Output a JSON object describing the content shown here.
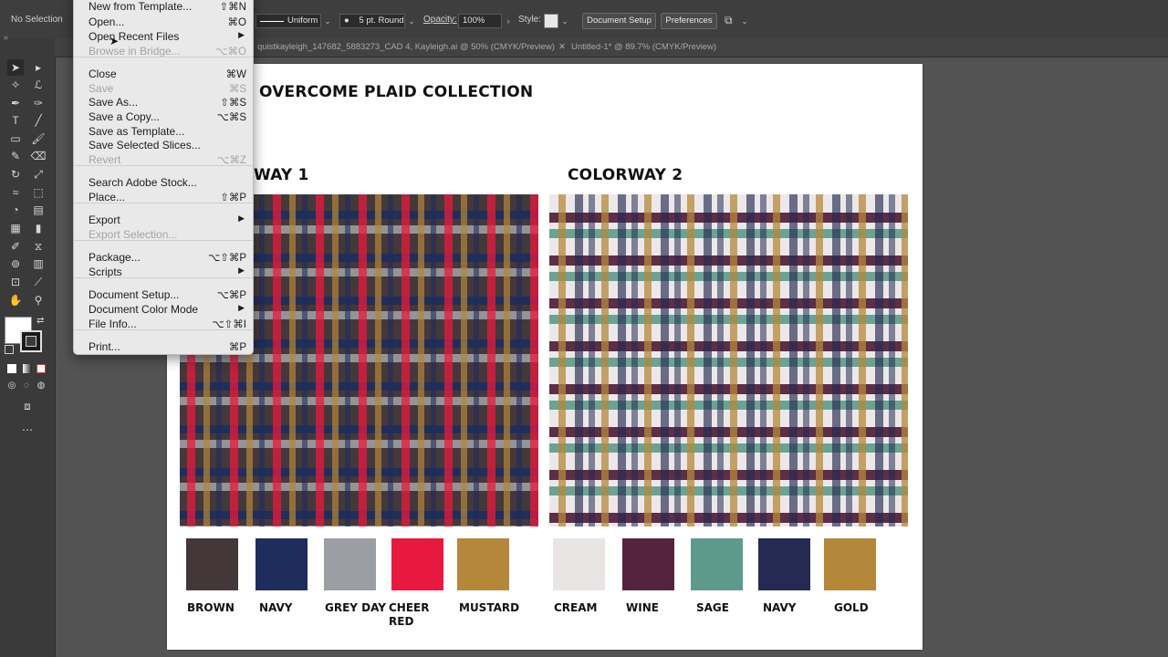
{
  "control_bar": {
    "selection": "No Selection",
    "stroke_profile": "Uniform",
    "brush": "5 pt. Round",
    "opacity_label": "Opacity:",
    "opacity_value": "100%",
    "style_label": "Style:",
    "document_setup": "Document Setup",
    "preferences": "Preferences"
  },
  "tabs": [
    {
      "label": "quistkayleigh_147682_5883273_CAD 4, Kayleigh.ai @ 50% (CMYK/Preview)"
    },
    {
      "label": "Untitled-1* @ 89.7% (CMYK/Preview)"
    }
  ],
  "menu": {
    "items": [
      {
        "label": "New from Template...",
        "shortcut": "⇧⌘N",
        "disabled": false
      },
      {
        "label": "Open...",
        "shortcut": "⌘O",
        "disabled": false
      },
      {
        "label": "Open Recent Files",
        "shortcut": "",
        "submenu": true,
        "disabled": false
      },
      {
        "label": "Browse in Bridge...",
        "shortcut": "⌥⌘O",
        "disabled": true
      },
      {
        "label": "Close",
        "shortcut": "⌘W",
        "disabled": false
      },
      {
        "label": "Save",
        "shortcut": "⌘S",
        "disabled": true
      },
      {
        "label": "Save As...",
        "shortcut": "⇧⌘S",
        "disabled": false
      },
      {
        "label": "Save a Copy...",
        "shortcut": "⌥⌘S",
        "disabled": false
      },
      {
        "label": "Save as Template...",
        "shortcut": "",
        "disabled": false
      },
      {
        "label": "Save Selected Slices...",
        "shortcut": "",
        "disabled": false
      },
      {
        "label": "Revert",
        "shortcut": "⌥⌘Z",
        "disabled": true
      },
      {
        "label": "Search Adobe Stock...",
        "shortcut": "",
        "disabled": false
      },
      {
        "label": "Place...",
        "shortcut": "⇧⌘P",
        "disabled": false
      },
      {
        "label": "Export",
        "shortcut": "",
        "submenu": true,
        "disabled": false
      },
      {
        "label": "Export Selection...",
        "shortcut": "",
        "disabled": true
      },
      {
        "label": "Package...",
        "shortcut": "⌥⇧⌘P",
        "disabled": false
      },
      {
        "label": "Scripts",
        "shortcut": "",
        "submenu": true,
        "disabled": false
      },
      {
        "label": "Document Setup...",
        "shortcut": "⌥⌘P",
        "disabled": false
      },
      {
        "label": "Document Color Mode",
        "shortcut": "",
        "submenu": true,
        "disabled": false
      },
      {
        "label": "File Info...",
        "shortcut": "⌥⇧⌘I",
        "disabled": false
      },
      {
        "label": "Print...",
        "shortcut": "⌘P",
        "disabled": false
      }
    ]
  },
  "artboard": {
    "title": "OVERCOME PLAID COLLECTION",
    "colorway1_title": "WAY 1",
    "colorway2_title": "COLORWAY 2",
    "colorway1_swatches": [
      {
        "name": "BROWN",
        "color": "#44373a"
      },
      {
        "name": "NAVY",
        "color": "#1f2d5c"
      },
      {
        "name": "GREY DAY",
        "color": "#9b9ea3"
      },
      {
        "name": "CHEER RED",
        "color": "#e8193e"
      },
      {
        "name": "MUSTARD",
        "color": "#b4873a"
      }
    ],
    "colorway2_swatches": [
      {
        "name": "CREAM",
        "color": "#e9e5e5"
      },
      {
        "name": "WINE",
        "color": "#54243f"
      },
      {
        "name": "SAGE",
        "color": "#5e9a8b"
      },
      {
        "name": "NAVY",
        "color": "#252a52"
      },
      {
        "name": "GOLD",
        "color": "#b4883a"
      }
    ]
  }
}
